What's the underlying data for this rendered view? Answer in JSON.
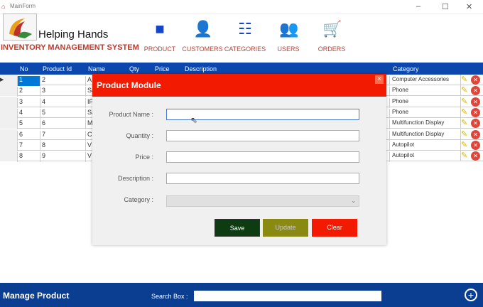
{
  "window": {
    "title": "MainForm"
  },
  "brand": {
    "name": "Helping Hands",
    "subtitle": "INVENTORY MANAGEMENT SYSTEM"
  },
  "nav": [
    {
      "label": "PRODUCT",
      "icon": "product-icon"
    },
    {
      "label": "CUSTOMERS",
      "icon": "customer-icon"
    },
    {
      "label": "CATEGORIES",
      "icon": "categories-icon"
    },
    {
      "label": "USERS",
      "icon": "users-icon"
    },
    {
      "label": "ORDERS",
      "icon": "cart-icon"
    }
  ],
  "table": {
    "columns": [
      "No",
      "Product Id",
      "Name",
      "Qty",
      "Price",
      "Description",
      "Category"
    ],
    "rows": [
      {
        "no": "1",
        "pid": "2",
        "name": "A",
        "category": "Computer Accessories"
      },
      {
        "no": "2",
        "pid": "3",
        "name": "Sa",
        "category": "Phone"
      },
      {
        "no": "3",
        "pid": "4",
        "name": "IP",
        "category": "Phone"
      },
      {
        "no": "4",
        "pid": "5",
        "name": "Sa",
        "category": "Phone"
      },
      {
        "no": "5",
        "pid": "6",
        "name": "M",
        "category": "Multifunction Display"
      },
      {
        "no": "6",
        "pid": "7",
        "name": "C",
        "category": "Multifunction Display"
      },
      {
        "no": "7",
        "pid": "8",
        "name": "V",
        "category": "Autopilot"
      },
      {
        "no": "8",
        "pid": "9",
        "name": "V",
        "category": "Autopilot"
      }
    ]
  },
  "dialog": {
    "title": "Product Module",
    "close": "×",
    "fields": [
      {
        "label": "Product Name :",
        "value": ""
      },
      {
        "label": "Quantity :",
        "value": ""
      },
      {
        "label": "Price :",
        "value": ""
      },
      {
        "label": "Description :",
        "value": ""
      }
    ],
    "category_label": "Category :",
    "category_value": "",
    "save": "Save",
    "update": "Update",
    "clear": "Clear"
  },
  "footer": {
    "title": "Manage Product",
    "search_label": "Search Box :",
    "search_value": ""
  }
}
